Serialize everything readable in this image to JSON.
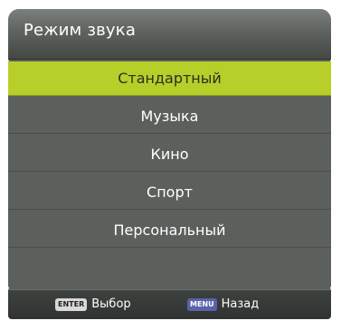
{
  "menu": {
    "title": "Режим звука",
    "options": [
      {
        "label": "Стандартный",
        "selected": true
      },
      {
        "label": "Музыка",
        "selected": false
      },
      {
        "label": "Кино",
        "selected": false
      },
      {
        "label": "Спорт",
        "selected": false
      },
      {
        "label": "Персональный",
        "selected": false
      },
      {
        "label": "",
        "selected": false
      }
    ]
  },
  "footer": {
    "select_key": "ENTER",
    "select_label": "Выбор",
    "back_key": "MENU",
    "back_label": "Назад"
  },
  "colors": {
    "highlight": "#b8cf2a",
    "panel": "#5c605d"
  }
}
